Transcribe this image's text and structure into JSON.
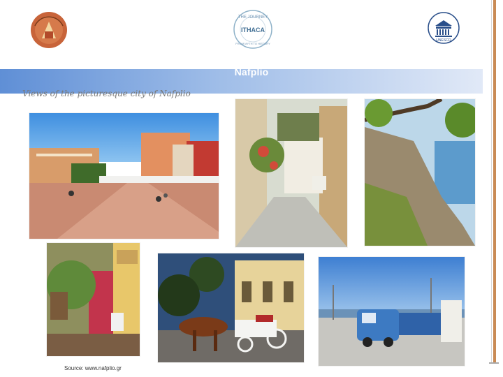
{
  "banner": {
    "title": "Nafplio"
  },
  "caption": "Views of the picturesque city of Nafplio",
  "source": "Source: www.nafplio.gr",
  "logos": {
    "left": {
      "icon": "crest-logo-icon"
    },
    "middle": {
      "line1": "THE JOURNEY",
      "line2": "ITHACA",
      "line3": "FROM MYTH TO HISTORY"
    },
    "right": {
      "text": "UNESCO"
    }
  },
  "photos": [
    {
      "name": "syntagma-square-photo"
    },
    {
      "name": "flower-street-photo"
    },
    {
      "name": "coastal-rocks-photo"
    },
    {
      "name": "colorful-alley-photo"
    },
    {
      "name": "horse-carriage-photo"
    },
    {
      "name": "tourist-train-photo"
    }
  ],
  "colors": {
    "banner_start": "#5f8fd6",
    "banner_end": "#e1e9f7",
    "accent_rule": "#c98b55"
  }
}
